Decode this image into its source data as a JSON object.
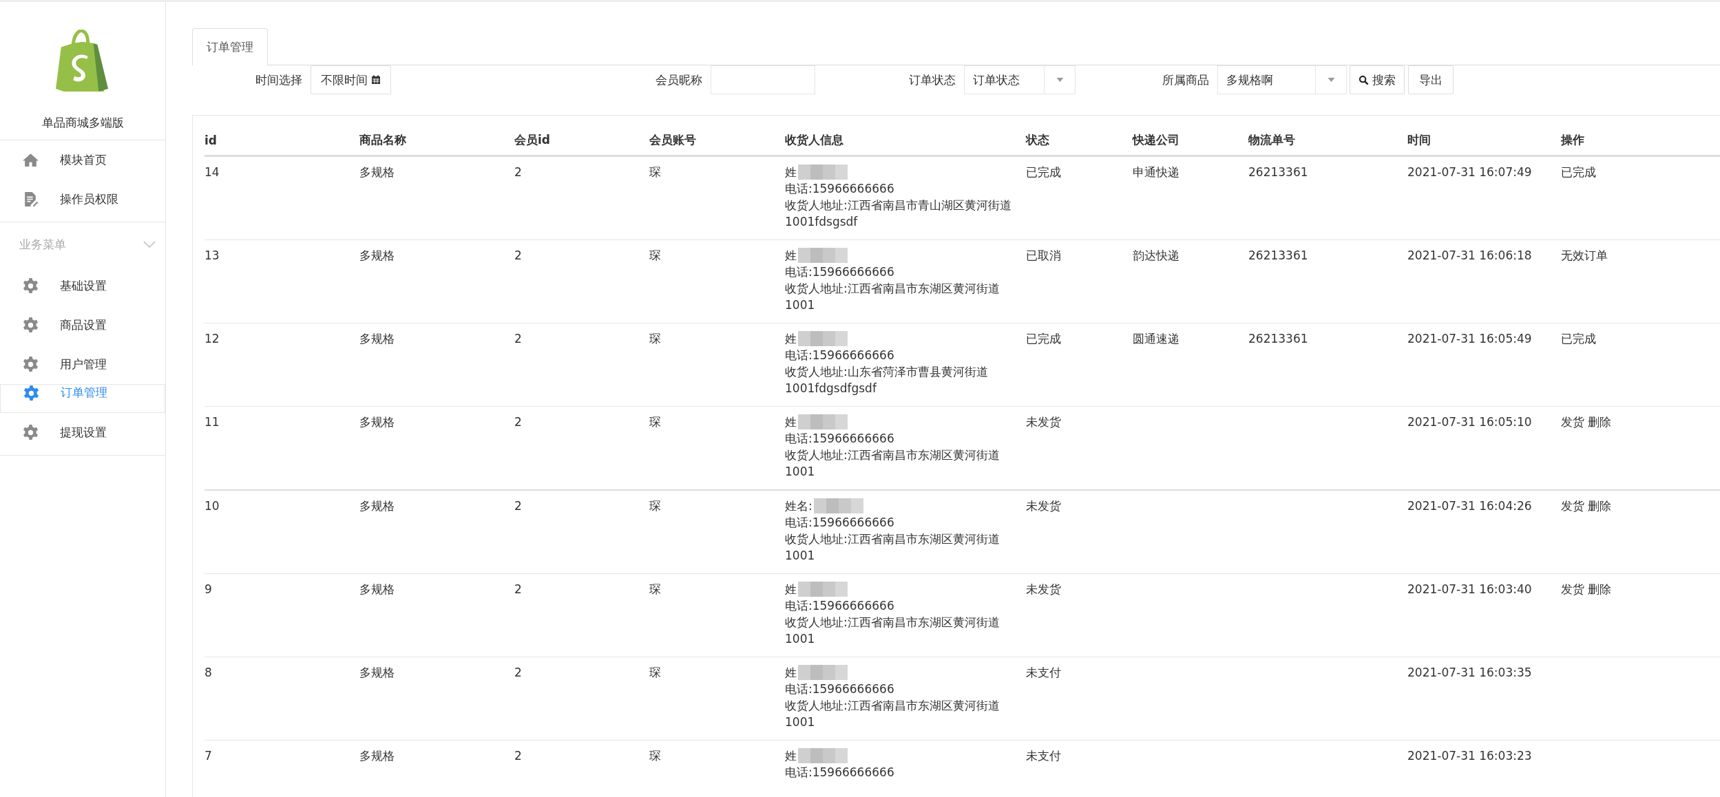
{
  "sidebar": {
    "brand": "单品商城多端版",
    "top_items": [
      {
        "label": "模块首页",
        "kind": "home",
        "selected": false
      },
      {
        "label": "操作员权限",
        "kind": "doc",
        "selected": false
      }
    ],
    "section": {
      "title": "业务菜单",
      "expanded": true
    },
    "items": [
      {
        "label": "基础设置",
        "kind": "gear",
        "selected": false
      },
      {
        "label": "商品设置",
        "kind": "gear",
        "selected": false
      },
      {
        "label": "用户管理",
        "kind": "gear",
        "selected": false
      },
      {
        "label": "订单管理",
        "kind": "gear",
        "selected": true
      },
      {
        "label": "提现设置",
        "kind": "gear",
        "selected": false
      }
    ]
  },
  "tabs": [
    {
      "label": "订单管理",
      "selected": true
    }
  ],
  "filters": {
    "time_label": "时间选择",
    "time_value": "不限时间",
    "nickname_label": "会员昵称",
    "status_label": "订单状态",
    "status_value": "订单状态",
    "product_label": "所属商品",
    "product_value": "多规格啊",
    "search_button": "搜索",
    "export_button": "导出"
  },
  "table": {
    "columns": [
      "id",
      "商品名称",
      "会员id",
      "会员账号",
      "收货人信息",
      "状态",
      "快递公司",
      "物流单号",
      "时间",
      "操作"
    ],
    "rows": [
      {
        "id": "14",
        "product": "多规格",
        "member_id": "2",
        "account": "琛",
        "recipient": {
          "name_label": "姓",
          "phone": "电话:15966666666",
          "address": "收货人地址:江西省南昌市青山湖区黄河街道1001fdsgsdf"
        },
        "status": "已完成",
        "courier": "申通快递",
        "tracking": "26213361",
        "time": "2021-07-31 16:07:49",
        "actions": [
          {
            "label": "已完成",
            "kind": "text"
          }
        ]
      },
      {
        "id": "13",
        "product": "多规格",
        "member_id": "2",
        "account": "琛",
        "recipient": {
          "name_label": "姓",
          "phone": "电话:15966666666",
          "address": "收货人地址:江西省南昌市东湖区黄河街道1001"
        },
        "status": "已取消",
        "courier": "韵达快递",
        "tracking": "26213361",
        "time": "2021-07-31 16:06:18",
        "actions": [
          {
            "label": "无效订单",
            "kind": "text"
          }
        ]
      },
      {
        "id": "12",
        "product": "多规格",
        "member_id": "2",
        "account": "琛",
        "recipient": {
          "name_label": "姓",
          "phone": "电话:15966666666",
          "address": "收货人地址:山东省菏泽市曹县黄河街道1001fdgsdfgsdf"
        },
        "status": "已完成",
        "courier": "圆通速递",
        "tracking": "26213361",
        "time": "2021-07-31 16:05:49",
        "actions": [
          {
            "label": "已完成",
            "kind": "text"
          }
        ]
      },
      {
        "id": "11",
        "product": "多规格",
        "member_id": "2",
        "account": "琛",
        "recipient": {
          "name_label": "姓",
          "phone": "电话:15966666666",
          "address": "收货人地址:江西省南昌市东湖区黄河街道1001"
        },
        "status": "未发货",
        "time": "2021-07-31 16:05:10",
        "actions": [
          {
            "label": "发货",
            "kind": "link"
          },
          {
            "label": "删除",
            "kind": "link"
          }
        ]
      },
      {
        "id": "10",
        "product": "多规格",
        "member_id": "2",
        "account": "琛",
        "recipient": {
          "name_label": "姓名:",
          "phone": "电话:15966666666",
          "address": "收货人地址:江西省南昌市东湖区黄河街道1001"
        },
        "status": "未发货",
        "time": "2021-07-31 16:04:26",
        "actions": [
          {
            "label": "发货",
            "kind": "link"
          },
          {
            "label": "删除",
            "kind": "link"
          }
        ]
      },
      {
        "id": "9",
        "product": "多规格",
        "member_id": "2",
        "account": "琛",
        "recipient": {
          "name_label": "姓",
          "phone": "电话:15966666666",
          "address": "收货人地址:江西省南昌市东湖区黄河街道1001"
        },
        "status": "未发货",
        "time": "2021-07-31 16:03:40",
        "actions": [
          {
            "label": "发货",
            "kind": "link"
          },
          {
            "label": "删除",
            "kind": "link"
          }
        ]
      },
      {
        "id": "8",
        "product": "多规格",
        "member_id": "2",
        "account": "琛",
        "recipient": {
          "name_label": "姓",
          "phone": "电话:15966666666",
          "address": "收货人地址:江西省南昌市东湖区黄河街道1001"
        },
        "status": "未支付",
        "time": "2021-07-31 16:03:35",
        "actions": []
      },
      {
        "id": "7",
        "product": "多规格",
        "member_id": "2",
        "account": "琛",
        "recipient": {
          "name_label": "姓",
          "phone": "电话:15966666666"
        },
        "status": "未支付",
        "time": "2021-07-31 16:03:23",
        "actions": []
      }
    ]
  }
}
